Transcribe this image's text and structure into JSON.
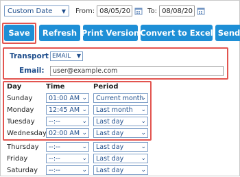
{
  "filter": {
    "date_range": "Custom Date",
    "from_label": "From:",
    "from_value": "08/05/20",
    "to_label": "To:",
    "to_value": "08/08/20"
  },
  "toolbar": {
    "save": "Save",
    "refresh": "Refresh",
    "print": "Print Version",
    "excel": "Convert to Excel",
    "send": "Send"
  },
  "transport": {
    "label": "Transport",
    "value": "EMAIL",
    "email_label": "Email:",
    "email_value": "user@example.com"
  },
  "schedule": {
    "headers": {
      "day": "Day",
      "time": "Time",
      "period": "Period"
    },
    "rows": [
      {
        "day": "Sunday",
        "time": "01:00 AM",
        "period": "Current month"
      },
      {
        "day": "Monday",
        "time": "12:45 AM",
        "period": "Last month"
      },
      {
        "day": "Tuesday",
        "time": "--:--",
        "period": "Last day"
      },
      {
        "day": "Wednesday",
        "time": "02:00 AM",
        "period": "Last day"
      },
      {
        "day": "Thursday",
        "time": "--:--",
        "period": "Last day"
      },
      {
        "day": "Friday",
        "time": "--:--",
        "period": "Last day"
      },
      {
        "day": "Saturday",
        "time": "--:--",
        "period": "Last day"
      }
    ]
  },
  "colors": {
    "button_blue": "#1e8fd6",
    "highlight_red": "#e2544f",
    "label_blue": "#1f4e8c"
  }
}
